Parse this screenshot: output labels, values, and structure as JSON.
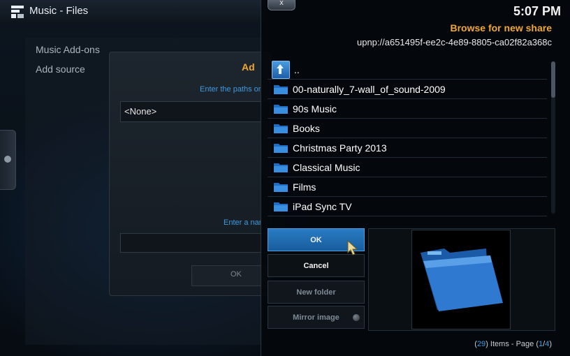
{
  "app": {
    "title": "Music - Files"
  },
  "left_menu": {
    "items": [
      "Music Add-ons",
      "Add source"
    ]
  },
  "source_dialog": {
    "header": "Ad",
    "paths_hint": "Enter the paths or",
    "path_value": "<None>",
    "name_hint": "Enter a nar",
    "ok_label": "OK"
  },
  "browse": {
    "close_label": "x",
    "clock": "5:07 PM",
    "title": "Browse for new share",
    "path": "upnp://a651495f-ee2c-4e89-8805-ca02f82a368c",
    "items": [
      {
        "label": "..",
        "icon": "up-arrow-icon"
      },
      {
        "label": "00-naturally_7-wall_of_sound-2009",
        "icon": "folder-icon"
      },
      {
        "label": "90s Music",
        "icon": "folder-icon"
      },
      {
        "label": "Books",
        "icon": "folder-icon"
      },
      {
        "label": "Christmas Party 2013",
        "icon": "folder-icon"
      },
      {
        "label": "Classical Music",
        "icon": "folder-icon"
      },
      {
        "label": "Films",
        "icon": "folder-icon"
      },
      {
        "label": "iPad Sync TV",
        "icon": "folder-icon"
      }
    ],
    "buttons": {
      "ok": "OK",
      "cancel": "Cancel",
      "new_folder": "New folder",
      "mirror_image": "Mirror image"
    },
    "footer": {
      "count": "29",
      "items_text": "Items - Page",
      "page_current": "1",
      "page_total": "4"
    }
  },
  "colors": {
    "accent_orange": "#f0a830",
    "accent_blue": "#3f9be0",
    "ok_button": "#1f6fb5"
  }
}
